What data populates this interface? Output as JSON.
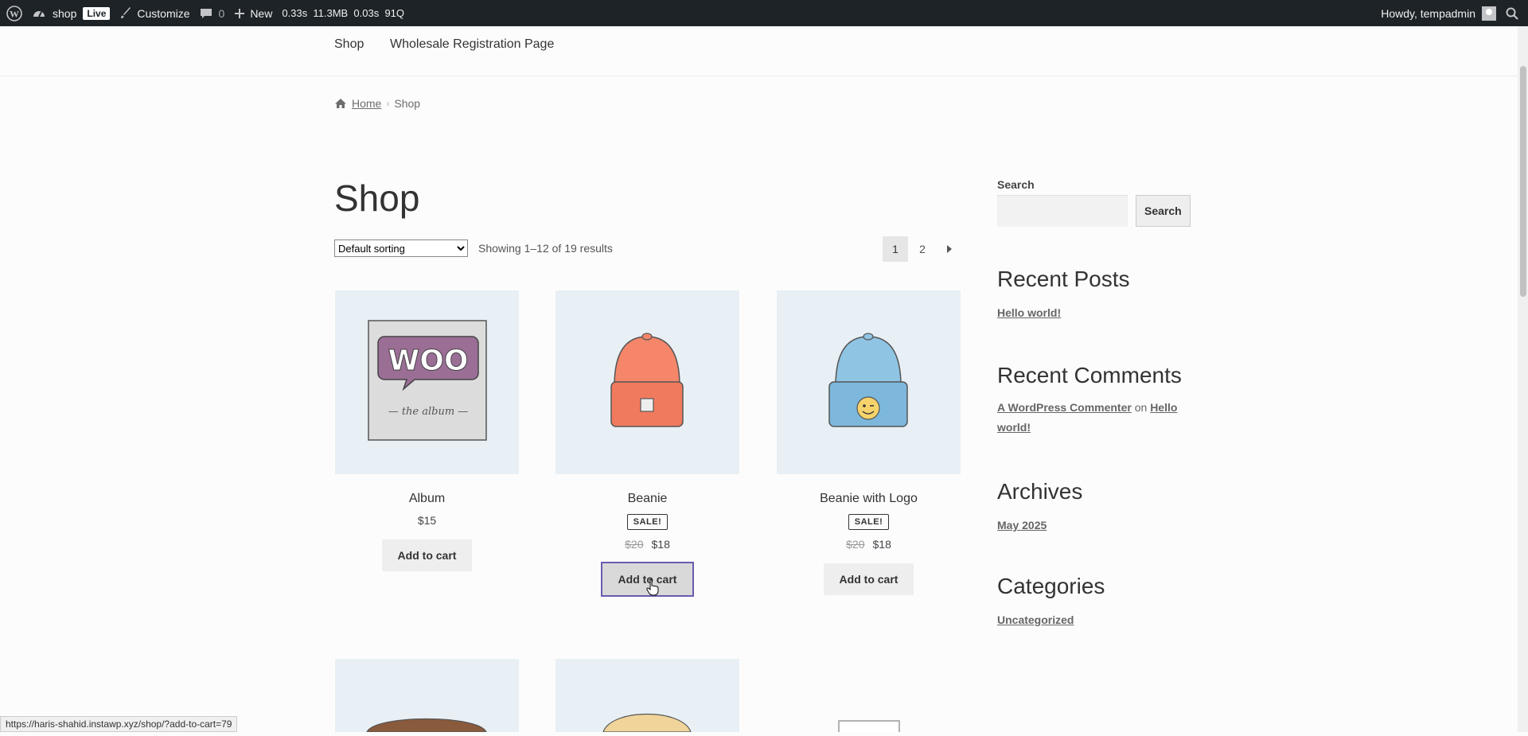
{
  "adminbar": {
    "site_name": "shop",
    "live_badge": "Live",
    "customize": "Customize",
    "comments_count": "0",
    "new": "New",
    "stats": "0.33s  11.3MB  0.03s  91Q",
    "howdy": "Howdy, tempadmin"
  },
  "nav": {
    "items": [
      {
        "label": "Shop"
      },
      {
        "label": "Wholesale Registration Page"
      }
    ]
  },
  "breadcrumb": {
    "home": "Home",
    "current": "Shop"
  },
  "page_title": "Shop",
  "toolbar": {
    "sorting": "Default sorting",
    "result_count": "Showing 1–12 of 19 results",
    "pages": [
      "1",
      "2"
    ],
    "current_page": "1"
  },
  "products": [
    {
      "name": "Album",
      "price": "$15",
      "add_label": "Add to cart"
    },
    {
      "name": "Beanie",
      "sale_badge": "SALE!",
      "old_price": "$20",
      "price": "$18",
      "add_label": "Add to cart"
    },
    {
      "name": "Beanie with Logo",
      "sale_badge": "SALE!",
      "old_price": "$20",
      "price": "$18",
      "add_label": "Add to cart"
    }
  ],
  "sidebar": {
    "search_label": "Search",
    "search_button": "Search",
    "recent_posts_title": "Recent Posts",
    "recent_posts": [
      "Hello world!"
    ],
    "recent_comments_title": "Recent Comments",
    "comment_author": "A WordPress Commenter",
    "comment_on": "on",
    "comment_post": "Hello world!",
    "archives_title": "Archives",
    "archives": [
      "May 2025"
    ],
    "categories_title": "Categories",
    "categories": [
      "Uncategorized"
    ]
  },
  "status_url": "https://haris-shahid.instawp.xyz/shop/?add-to-cart=79",
  "colors": {
    "admin_bar": "#1d2327",
    "product_bg": "#e8f0f5",
    "focus_outline": "#6b5bb0"
  }
}
